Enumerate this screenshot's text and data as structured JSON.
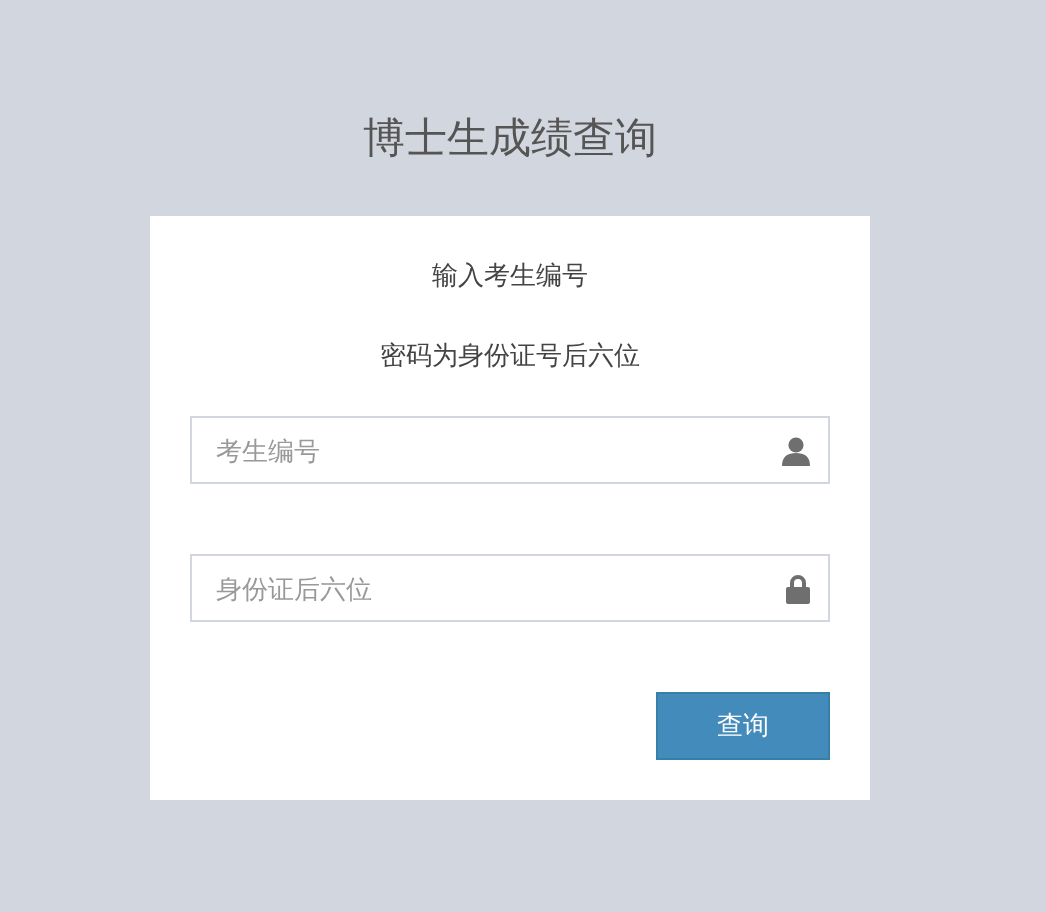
{
  "title": "博士生成绩查询",
  "card": {
    "lines": [
      "输入考生编号",
      "密码为身份证号后六位"
    ],
    "fields": [
      {
        "placeholder": "考生编号",
        "kind": "user"
      },
      {
        "placeholder": "身份证后六位",
        "kind": "lock"
      }
    ],
    "button": "查询"
  }
}
